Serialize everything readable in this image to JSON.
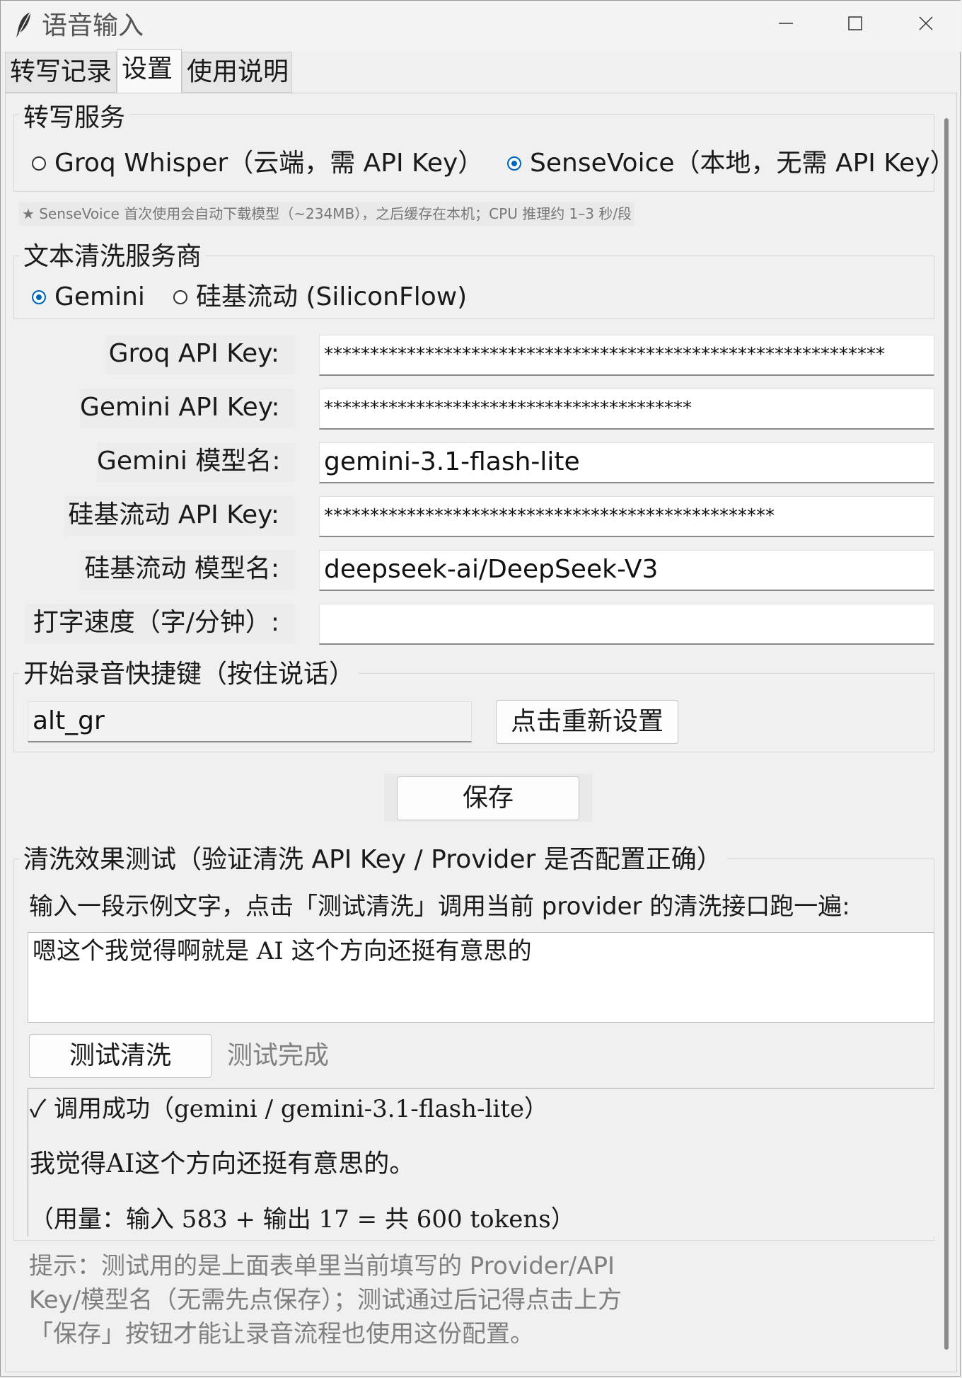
{
  "window": {
    "title": "语音输入"
  },
  "tabs": [
    {
      "label": "转写记录"
    },
    {
      "label": "设置"
    },
    {
      "label": "使用说明"
    }
  ],
  "transcribe_service": {
    "title": "转写服务",
    "options": [
      {
        "label": "Groq Whisper（云端，需 API Key）",
        "selected": false
      },
      {
        "label": "SenseVoice（本地，无需 API Key）",
        "selected": true
      }
    ],
    "note": "★ SenseVoice 首次使用会自动下载模型（~234MB），之后缓存在本机；CPU 推理约 1–3 秒/段"
  },
  "cleaning_provider": {
    "title": "文本清洗服务商",
    "options": [
      {
        "label": "Gemini",
        "selected": true
      },
      {
        "label": "硅基流动 (SiliconFlow)",
        "selected": false
      }
    ]
  },
  "fields": [
    {
      "label": "Groq API Key:",
      "value": "*************************************************************"
    },
    {
      "label": "Gemini API Key:",
      "value": "****************************************"
    },
    {
      "label": "Gemini 模型名:",
      "value": "gemini-3.1-flash-lite"
    },
    {
      "label": "硅基流动 API Key:",
      "value": "*************************************************"
    },
    {
      "label": "硅基流动 模型名:",
      "value": "deepseek-ai/DeepSeek-V3"
    },
    {
      "label": "打字速度（字/分钟）:",
      "value": ""
    }
  ],
  "hotkey": {
    "title": "开始录音快捷键（按住说话）",
    "value": "alt_gr",
    "reset_label": "点击重新设置"
  },
  "save_label": "保存",
  "test": {
    "title": "清洗效果测试（验证清洗 API Key / Provider 是否配置正确）",
    "instruction": "输入一段示例文字，点击「测试清洗」调用当前 provider 的清洗接口跑一遍:",
    "input_text": "嗯这个我觉得啊就是 AI 这个方向还挺有意思的",
    "button_label": "测试清洗",
    "status": "测试完成",
    "result_lines": [
      "✓ 调用成功（gemini / gemini-3.1-flash-lite）",
      "我觉得AI这个方向还挺有意思的。",
      "（用量：输入 583 + 输出 17 = 共 600 tokens）"
    ],
    "hint_lines": [
      "提示：测试用的是上面表单里当前填写的 Provider/API",
      "Key/模型名（无需先点保存）；测试通过后记得点击上方",
      "「保存」按钮才能让录音流程也使用这份配置。"
    ]
  },
  "colors": {
    "accent": "#0067c0",
    "background": "#f0f0f0",
    "muted_text": "#808080"
  }
}
